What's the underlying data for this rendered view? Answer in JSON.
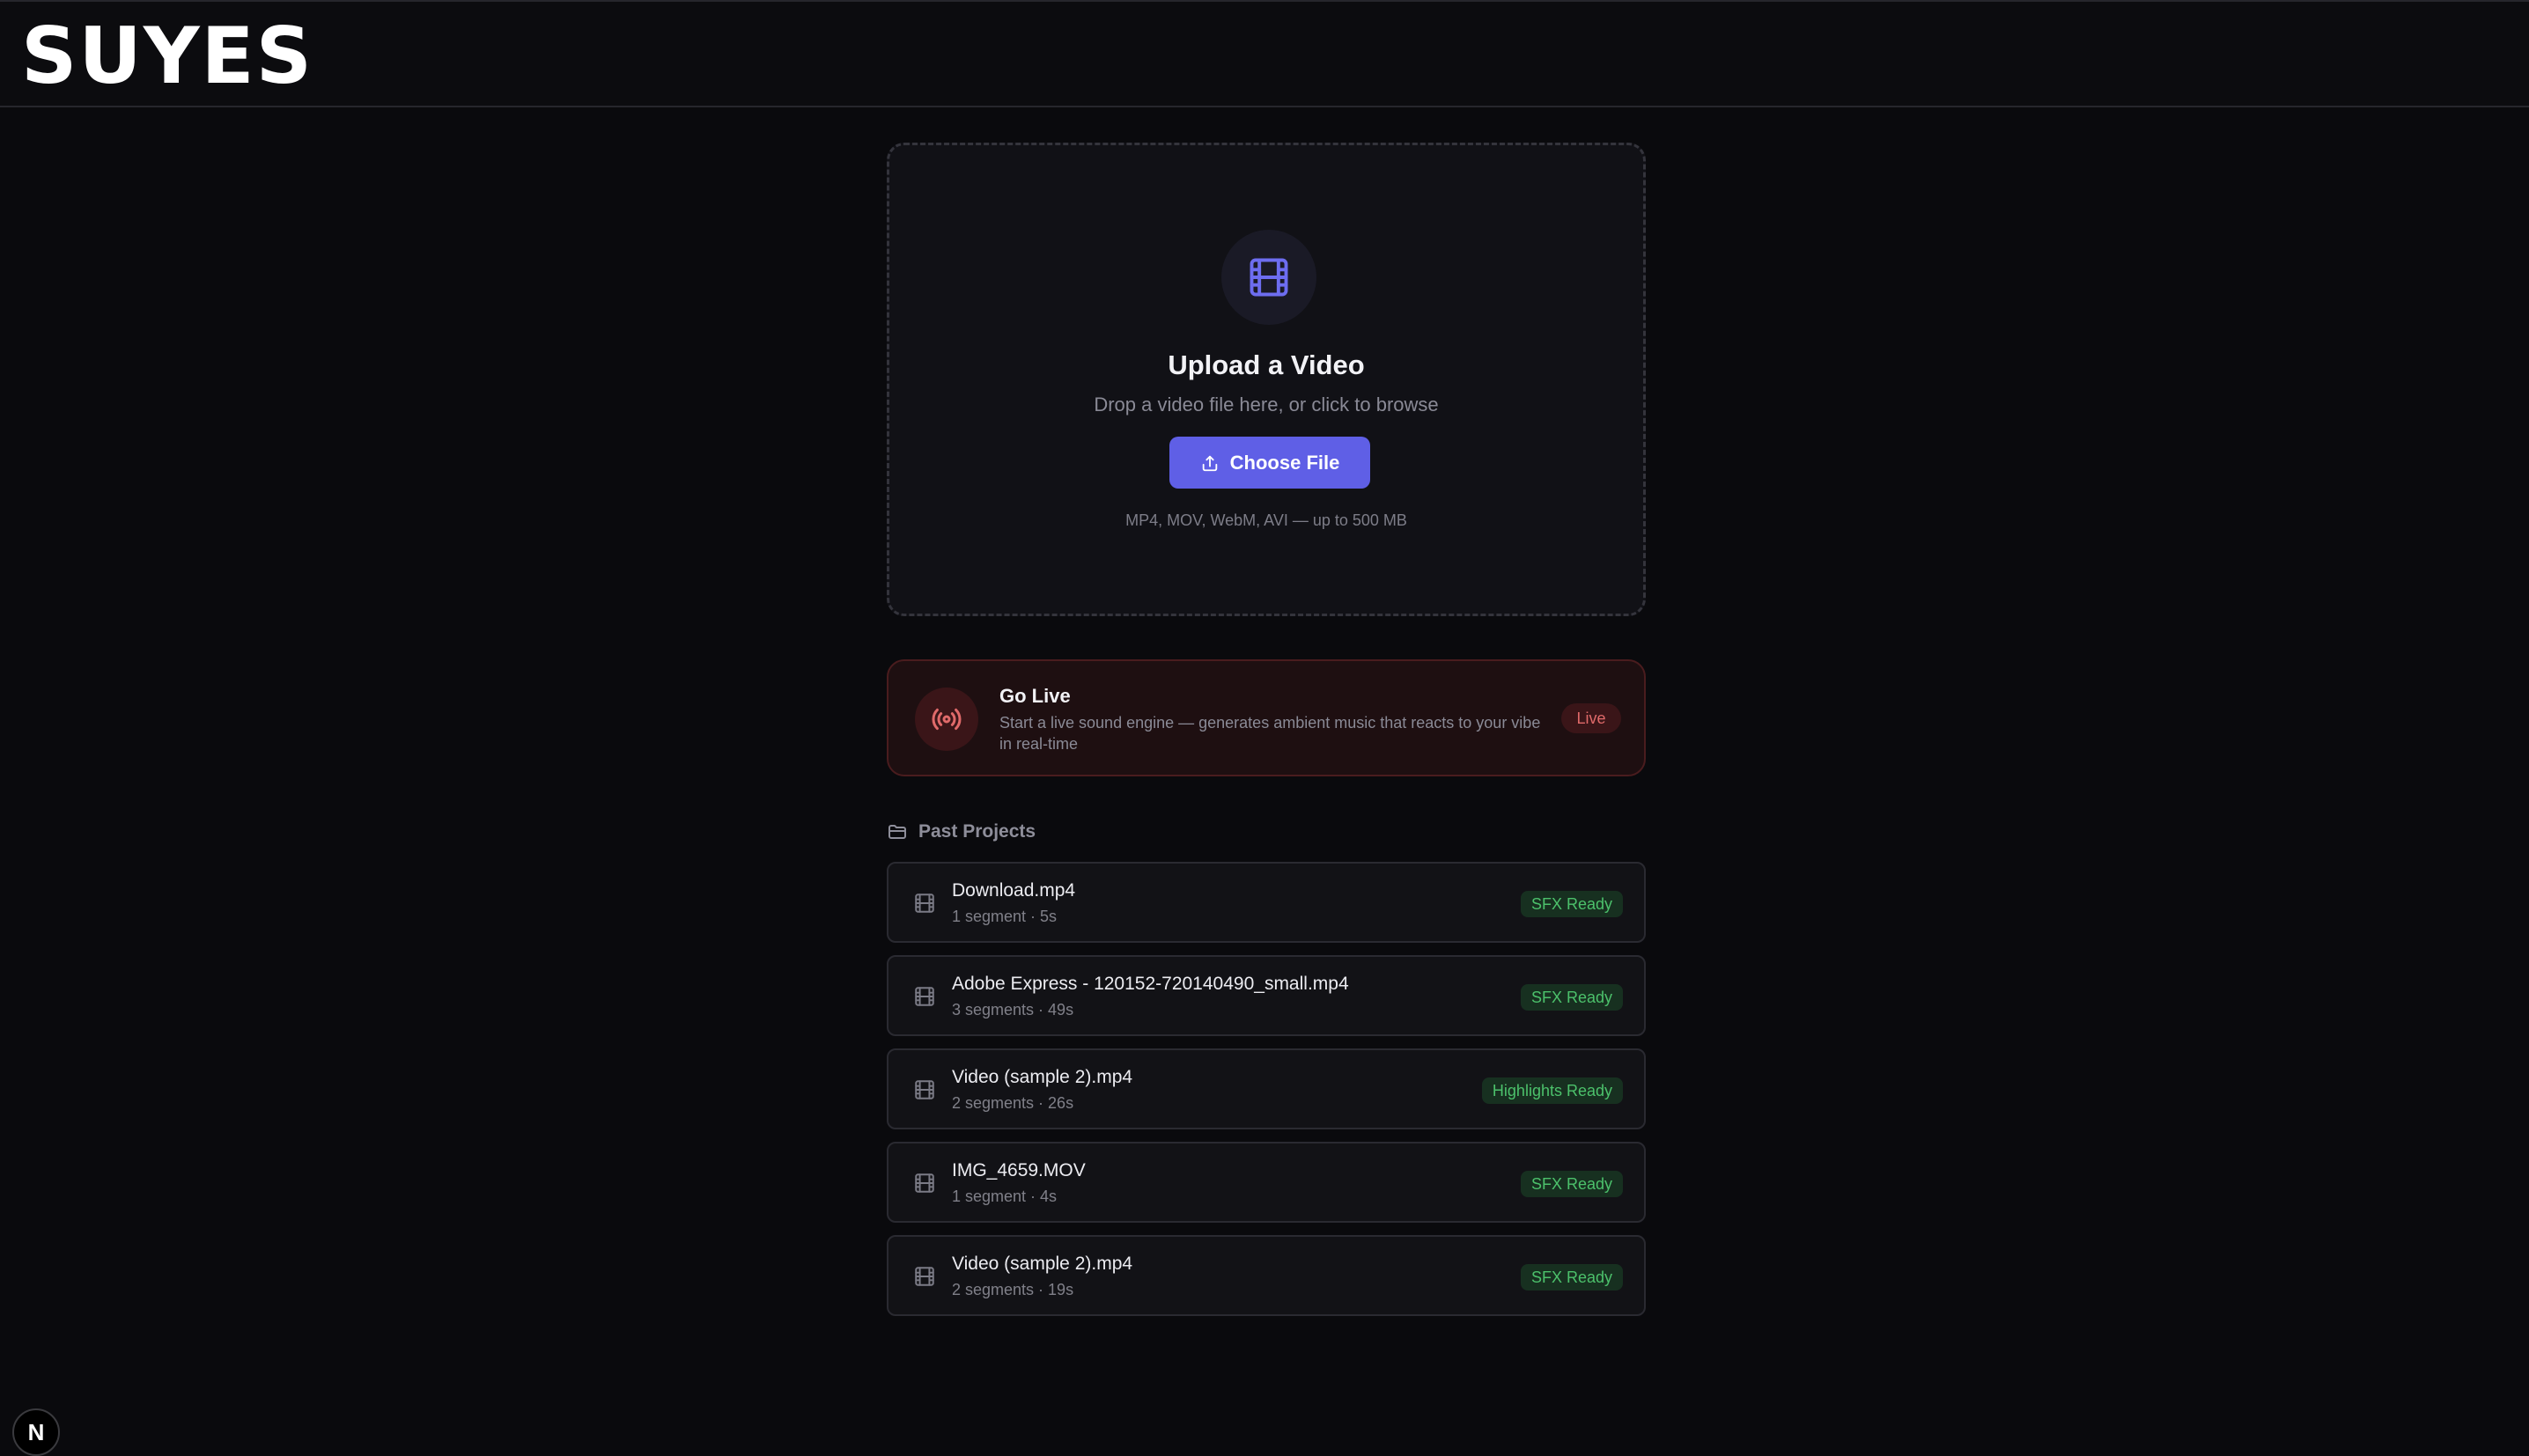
{
  "app": {
    "logo": "SUYES"
  },
  "upload": {
    "icon": "film-icon",
    "title": "Upload a Video",
    "subtitle": "Drop a video file here, or click to browse",
    "button_label": "Choose File",
    "button_icon": "upload-icon",
    "formats": "MP4, MOV, WebM, AVI — up to 500 MB"
  },
  "golive": {
    "icon": "broadcast-icon",
    "title": "Go Live",
    "description": "Start a live sound engine — generates ambient music that reacts to your vibe in real-time",
    "badge": "Live"
  },
  "past_projects": {
    "icon": "folder-icon",
    "title": "Past Projects",
    "items": [
      {
        "name": "Download.mp4",
        "meta": "1 segment · 5s",
        "status": "SFX Ready"
      },
      {
        "name": "Adobe Express - 120152-720140490_small.mp4",
        "meta": "3 segments · 49s",
        "status": "SFX Ready"
      },
      {
        "name": "Video (sample 2).mp4",
        "meta": "2 segments · 26s",
        "status": "Highlights Ready"
      },
      {
        "name": "IMG_4659.MOV",
        "meta": "1 segment · 4s",
        "status": "SFX Ready"
      },
      {
        "name": "Video (sample 2).mp4",
        "meta": "2 segments · 19s",
        "status": "SFX Ready"
      }
    ]
  },
  "dev_badge": {
    "label": "N"
  },
  "colors": {
    "background": "#0a0a0d",
    "accent": "#5f5fe6",
    "live_red": "#e06a6a",
    "ready_green": "#4cc16b"
  }
}
